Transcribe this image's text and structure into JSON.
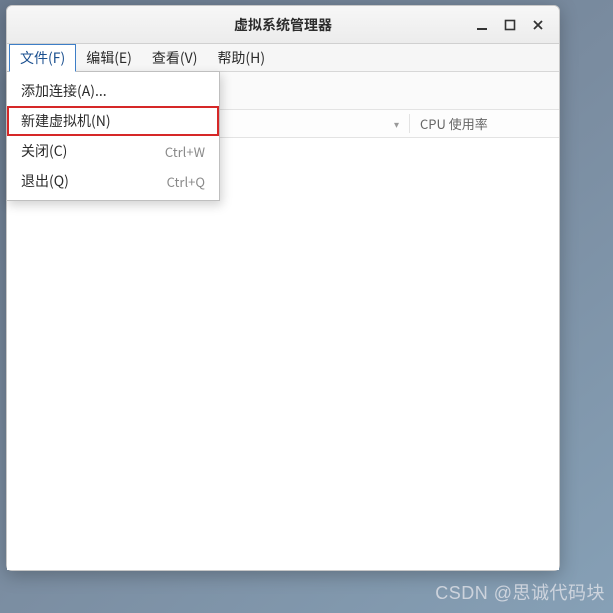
{
  "window": {
    "title": "虚拟系统管理器"
  },
  "menubar": {
    "file": "文件(F)",
    "edit": "编辑(E)",
    "view": "查看(V)",
    "help": "帮助(H)"
  },
  "file_menu": {
    "add_connection": "添加连接(A)...",
    "new_vm": "新建虚拟机(N)",
    "close": {
      "label": "关闭(C)",
      "accel": "Ctrl+W"
    },
    "quit": {
      "label": "退出(Q)",
      "accel": "Ctrl+Q"
    }
  },
  "columns": {
    "cpu": "CPU 使用率"
  },
  "watermark": "CSDN @思诚代码块"
}
